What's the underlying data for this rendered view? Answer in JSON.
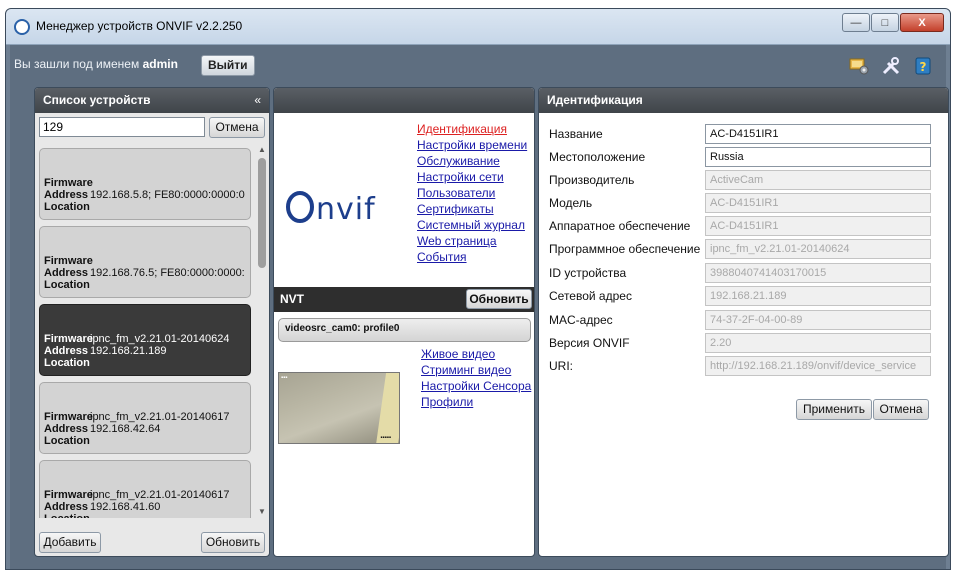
{
  "window": {
    "title": "Менеджер устройств ONVIF v2.2.250",
    "min_label": "—",
    "max_label": "□",
    "close_label": "X"
  },
  "topbar": {
    "logged_prefix": "Вы зашли под именем",
    "username": "admin",
    "logout_label": "Выйти",
    "icons": [
      "monitor-settings-icon",
      "tools-icon",
      "help-icon"
    ]
  },
  "device_list": {
    "title": "Список устройств",
    "collapse_glyph": "«",
    "search_value": "129",
    "cancel_label": "Отмена",
    "field_labels": {
      "firmware": "Firmware",
      "address": "Address",
      "location": "Location"
    },
    "devices": [
      {
        "firmware": "",
        "address": "192.168.5.8; FE80:0000:0000:0",
        "location": "",
        "selected": false
      },
      {
        "firmware": "",
        "address": "192.168.76.5; FE80:0000:0000:",
        "location": "",
        "selected": false
      },
      {
        "firmware": "ipnc_fm_v2.21.01-20140624",
        "address": "192.168.21.189",
        "location": "",
        "selected": true
      },
      {
        "firmware": "ipnc_fm_v2.21.01-20140617",
        "address": "192.168.42.64",
        "location": "",
        "selected": false
      },
      {
        "firmware": "ipnc_fm_v2.21.01-20140617",
        "address": "192.168.41.60",
        "location": "",
        "selected": false
      }
    ],
    "add_label": "Добавить",
    "refresh_label": "Обновить"
  },
  "device_menu": {
    "items": [
      {
        "label": "Идентификация",
        "active": true
      },
      {
        "label": "Настройки времени",
        "active": false
      },
      {
        "label": "Обслуживание",
        "active": false
      },
      {
        "label": "Настройки сети",
        "active": false
      },
      {
        "label": "Пользователи",
        "active": false
      },
      {
        "label": "Сертификаты",
        "active": false
      },
      {
        "label": "Системный журнал",
        "active": false
      },
      {
        "label": "Web страница",
        "active": false
      },
      {
        "label": "События",
        "active": false
      }
    ],
    "logo_text": "ONVIF"
  },
  "nvt": {
    "title": "NVT",
    "refresh_label": "Обновить",
    "profile": "videosrc_cam0: profile0",
    "video_menu": [
      "Живое видео",
      "Стриминг видео",
      "Настройки Сенсора",
      "Профили"
    ]
  },
  "identification": {
    "title": "Идентификация",
    "fields": [
      {
        "label": "Название",
        "value": "AC-D4151IR1",
        "readonly": false
      },
      {
        "label": "Местоположение",
        "value": "Russia",
        "readonly": false
      },
      {
        "label": "Производитель",
        "value": "ActiveCam",
        "readonly": true
      },
      {
        "label": "Модель",
        "value": "AC-D4151IR1",
        "readonly": true
      },
      {
        "label": "Аппаратное обеспечение",
        "value": "AC-D4151IR1",
        "readonly": true
      },
      {
        "label": "Программное обеспечение",
        "value": "ipnc_fm_v2.21.01-20140624",
        "readonly": true
      },
      {
        "label": "ID устройства",
        "value": "398804074140317001​5",
        "readonly": true
      },
      {
        "label": "Сетевой адрес",
        "value": "192.168.21.189",
        "readonly": true
      },
      {
        "label": "MAC-адрес",
        "value": "74-37-2F-04-00-89",
        "readonly": true
      },
      {
        "label": "Версия ONVIF",
        "value": "2.20",
        "readonly": true
      },
      {
        "label": "URI:",
        "value": "http://192.168.21.189/onvif/device_service",
        "readonly": true
      }
    ],
    "apply_label": "Применить",
    "cancel_label": "Отмена"
  }
}
